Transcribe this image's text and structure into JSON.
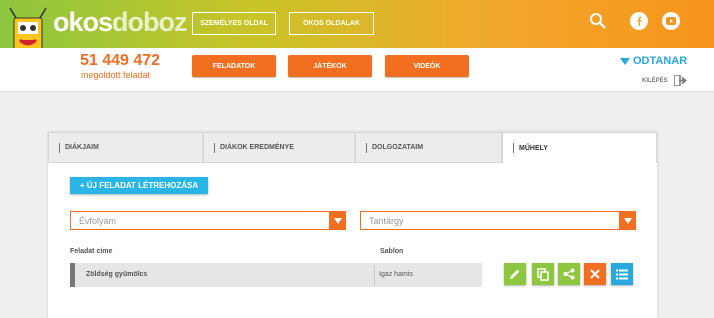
{
  "header": {
    "logo_okos": "okos",
    "logo_doboz": "doboz",
    "personal_page": "SZEMÉLYES OLDAL",
    "smart_pages": "OKOS OLDALAK",
    "brand_color": "#8dc63f",
    "accent_color": "#f26f21"
  },
  "stats": {
    "count": "51 449 472",
    "count_label": "megoldott feladat"
  },
  "nav": {
    "tasks": "FELADATOK",
    "games": "JÁTÉKOK",
    "videos": "VIDEÓK"
  },
  "user": {
    "name": "ODTANAR",
    "logout": "KILÉPÉS"
  },
  "tabs": [
    "DIÁKJAIM",
    "DIÁKOK EREDMÉNYE",
    "DOLGOZATAIM",
    "MŰHELY"
  ],
  "workshop": {
    "new_task": "+ ÚJ FELADAT LÉTREHOZÁSA",
    "grade_placeholder": "Évfolyam",
    "subject_placeholder": "Tantárgy",
    "columns": [
      "Feladat címe",
      "Sablon"
    ],
    "rows": [
      {
        "title": "Zöldség gyümölcs",
        "template": "Igaz hamis"
      }
    ],
    "actions": [
      "edit-icon",
      "copy-icon",
      "share-icon",
      "delete-icon",
      "list-icon"
    ]
  }
}
